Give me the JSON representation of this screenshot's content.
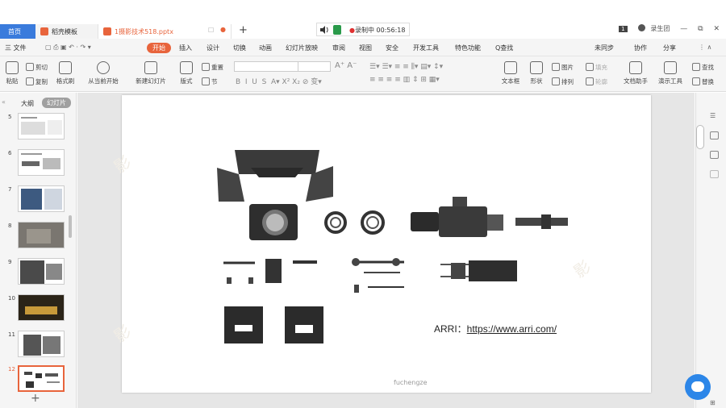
{
  "titlebar": {
    "tab_home": "首页",
    "tab_template": "稻壳模板",
    "tab_file": "1摄影技术518.pptx",
    "new_tab": "+",
    "recording": "录制中 00:56:18",
    "user": "录生团"
  },
  "menu": {
    "file": "三 文件",
    "items": [
      "开始",
      "插入",
      "设计",
      "切换",
      "动画",
      "幻灯片放映",
      "审阅",
      "视图",
      "安全",
      "开发工具",
      "特色功能",
      "Q查找"
    ],
    "right": [
      "未同步",
      "协作",
      "分享"
    ]
  },
  "ribbon": {
    "paste": "粘贴",
    "cut": "剪切",
    "copy": "复制",
    "format_painter": "格式刷",
    "from_current": "从当前开始",
    "new_slide": "新建幻灯片",
    "layout": "版式",
    "reset": "重置",
    "section": "节",
    "textbox": "文本框",
    "shape": "形状",
    "picture": "图片",
    "arrange": "排列",
    "fill": "填充",
    "outline": "轮廓",
    "doc_assistant": "文档助手",
    "present_tools": "演示工具",
    "find": "查找",
    "replace": "替换"
  },
  "left_panel": {
    "outline_tab": "大纲",
    "slides_tab": "幻灯片",
    "slide_numbers": [
      "5",
      "6",
      "7",
      "8",
      "9",
      "10",
      "11",
      "12"
    ],
    "selected": "12",
    "add": "+"
  },
  "slide": {
    "arri_label": "ARRI：",
    "arri_link": "https://www.arri.com/",
    "footer": "fuchengze"
  },
  "colors": {
    "accent": "#e8643c",
    "home_tab": "#3a7bdc",
    "chat": "#2c86e8"
  }
}
